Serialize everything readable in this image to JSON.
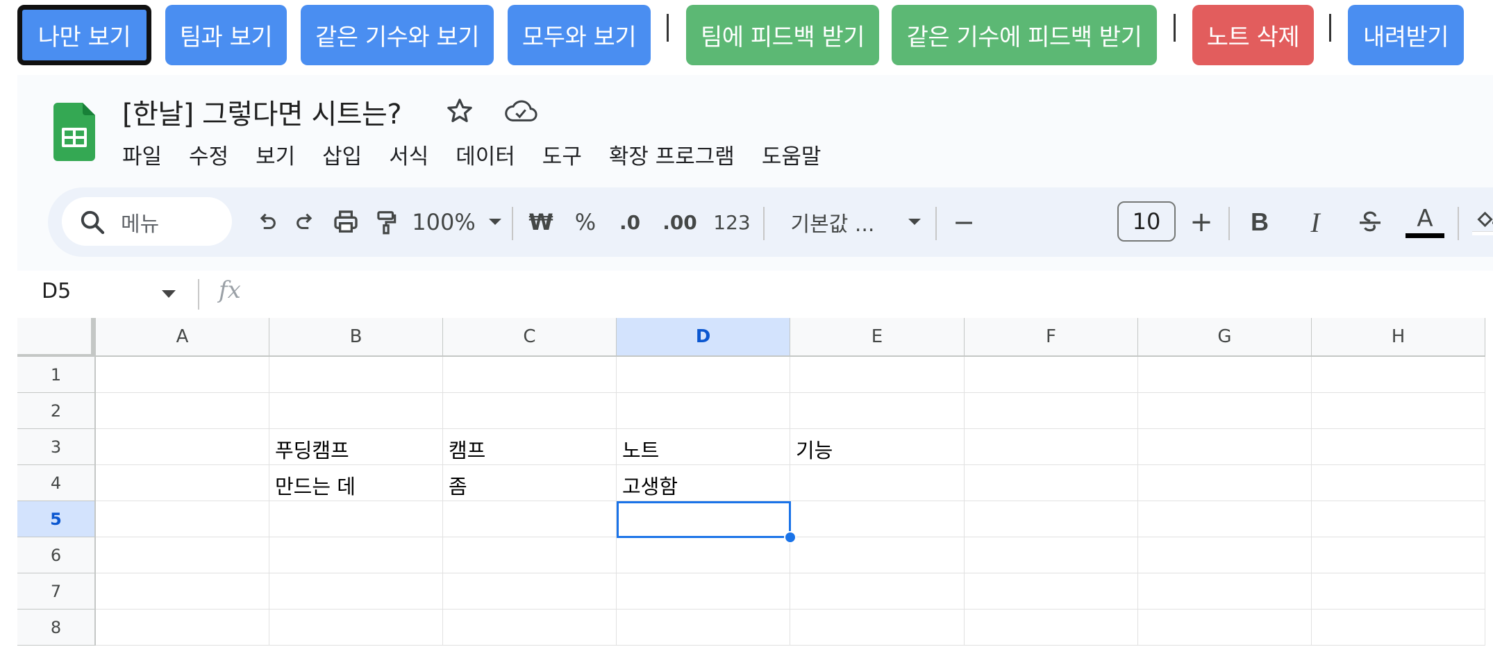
{
  "actions": {
    "only_me": "나만 보기",
    "with_team": "팀과 보기",
    "with_cohort": "같은 기수와 보기",
    "with_all": "모두와 보기",
    "team_feedback": "팀에 피드백 받기",
    "cohort_feedback": "같은 기수에 피드백 받기",
    "delete_note": "노트 삭제",
    "download": "내려받기"
  },
  "doc": {
    "title": "[한날] 그렇다면 시트는?"
  },
  "menu": [
    "파일",
    "수정",
    "보기",
    "삽입",
    "서식",
    "데이터",
    "도구",
    "확장 프로그램",
    "도움말"
  ],
  "toolbar": {
    "search_placeholder": "메뉴",
    "zoom": "100%",
    "currency": "₩",
    "percent": "%",
    "dec_decrease": ".0",
    "dec_increase": ".00",
    "number_format": "123",
    "font": "기본값 ...",
    "minus": "−",
    "font_size": "10",
    "plus": "+",
    "bold": "B",
    "italic": "I",
    "text_color": "A"
  },
  "formula_bar": {
    "name_box": "D5",
    "fx": "fx",
    "content": ""
  },
  "grid": {
    "columns": [
      "A",
      "B",
      "C",
      "D",
      "E",
      "F",
      "G",
      "H"
    ],
    "rows": [
      "1",
      "2",
      "3",
      "4",
      "5",
      "6",
      "7",
      "8"
    ],
    "selected_cell": "D5",
    "cells": {
      "B3": "푸딩캠프",
      "C3": "캠프",
      "D3": "노트",
      "E3": "기능",
      "B4": "만드는 데",
      "C4": "좀",
      "D4": "고생함"
    }
  }
}
